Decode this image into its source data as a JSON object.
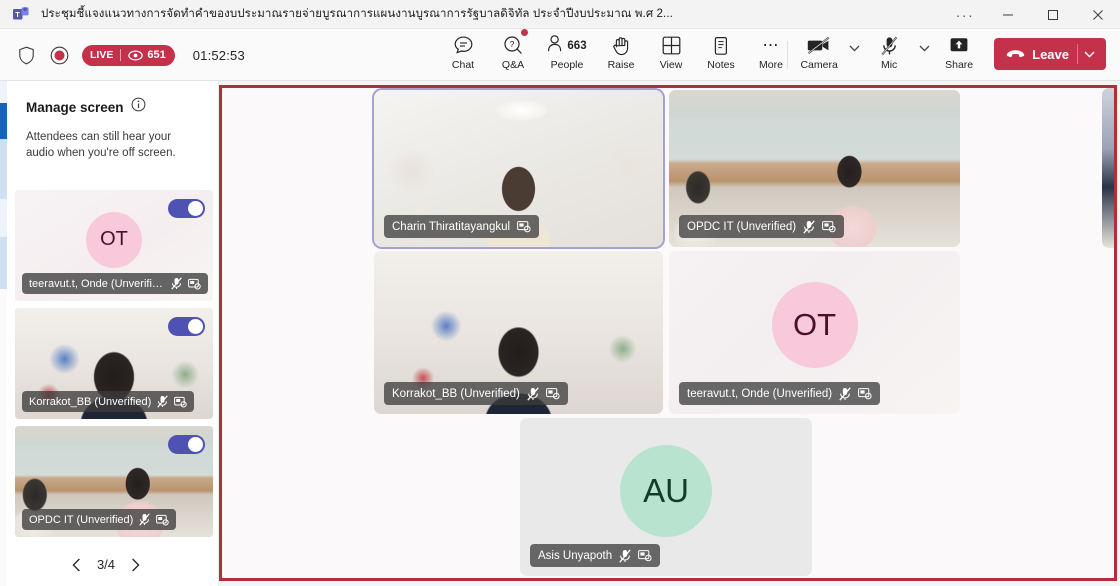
{
  "window": {
    "title": "ประชุมชี้แจงแนวทางการจัดทำคำของบประมาณรายจ่ายบูรณาการแผนงานบูรณาการรัฐบาลดิจิทัล ประจำปีงบประมาณ พ.ศ 2...",
    "app_icon": "teams-icon",
    "more_label": "···",
    "minimize_label": "minimize-icon",
    "maximize_label": "maximize-icon",
    "close_label": "close-icon"
  },
  "toolbar": {
    "shield_icon": "shield-icon",
    "record_icon": "record-icon",
    "live_label": "LIVE",
    "viewer_count": "651",
    "eye_icon": "eye-icon",
    "timer": "01:52:53",
    "center_items": [
      {
        "label": "Chat",
        "icon": "chat-icon",
        "badge": false
      },
      {
        "label": "Q&A",
        "icon": "qa-icon",
        "badge": true
      },
      {
        "label": "People",
        "icon": "people-icon",
        "count": "663"
      },
      {
        "label": "Raise",
        "icon": "raise-hand-icon",
        "badge": false
      },
      {
        "label": "View",
        "icon": "grid-view-icon",
        "badge": false
      },
      {
        "label": "Notes",
        "icon": "notes-icon",
        "badge": false
      },
      {
        "label": "More",
        "icon": "more-icon",
        "badge": false
      }
    ],
    "camera_label": "Camera",
    "camera_icon": "camera-off-icon",
    "mic_label": "Mic",
    "mic_icon": "mic-off-icon",
    "share_label": "Share",
    "share_icon": "share-screen-icon",
    "leave_label": "Leave",
    "leave_icon": "hangup-icon",
    "leave_color": "#c4314b",
    "chevron_icon": "chevron-down-icon"
  },
  "sidebar": {
    "panel_title": "Manage screen",
    "info_icon": "info-icon",
    "description": "Attendees can still hear your audio when you're off screen.",
    "thumbnails": [
      {
        "name": "teeravut.t, Onde (Unverified)",
        "toggle_on": true,
        "avatar_initials": "OT",
        "avatar_color": "#f7c9da",
        "avatar_text_color": "#4b1029",
        "mic_icon": "mic-off-icon",
        "video_icon": "video-spotlight-icon",
        "has_video": false
      },
      {
        "name": "Korrakot_BB (Unverified)",
        "toggle_on": true,
        "mic_icon": "mic-off-icon",
        "video_icon": "video-spotlight-icon",
        "has_video": true
      },
      {
        "name": "OPDC IT (Unverified)",
        "toggle_on": true,
        "mic_icon": "mic-off-icon",
        "video_icon": "video-spotlight-icon",
        "has_video": true
      }
    ],
    "pagination": {
      "prev_icon": "chevron-left-icon",
      "page_label": "3/4",
      "next_icon": "chevron-right-icon"
    }
  },
  "stage": {
    "annotation_border_color": "#b0303a",
    "active_speaker_border_color": "#a6a0d9",
    "tiles": [
      {
        "name": "Charin Thiratitayangkul",
        "has_video": true,
        "is_speaking": true,
        "mic_muted": false,
        "video_icon": "video-spotlight-icon"
      },
      {
        "name": "OPDC IT (Unverified)",
        "has_video": true,
        "is_speaking": false,
        "mic_muted": true,
        "mic_icon": "mic-off-icon",
        "video_icon": "video-spotlight-icon"
      },
      {
        "name": "Korrakot_BB (Unverified)",
        "has_video": true,
        "is_speaking": false,
        "mic_muted": true,
        "mic_icon": "mic-off-icon",
        "video_icon": "video-spotlight-icon"
      },
      {
        "name": "teeravut.t, Onde (Unverified)",
        "has_video": false,
        "is_speaking": false,
        "mic_muted": true,
        "mic_icon": "mic-off-icon",
        "video_icon": "video-spotlight-icon",
        "avatar_initials": "OT",
        "avatar_color": "#f7c9da",
        "avatar_text_color": "#4b1029"
      },
      {
        "name": "Asis Unyapoth",
        "has_video": false,
        "is_speaking": false,
        "mic_muted": true,
        "mic_icon": "mic-off-icon",
        "video_icon": "video-spotlight-icon",
        "avatar_initials": "AU",
        "avatar_color": "#b8e3ce",
        "avatar_text_color": "#0f3d2a"
      }
    ]
  }
}
